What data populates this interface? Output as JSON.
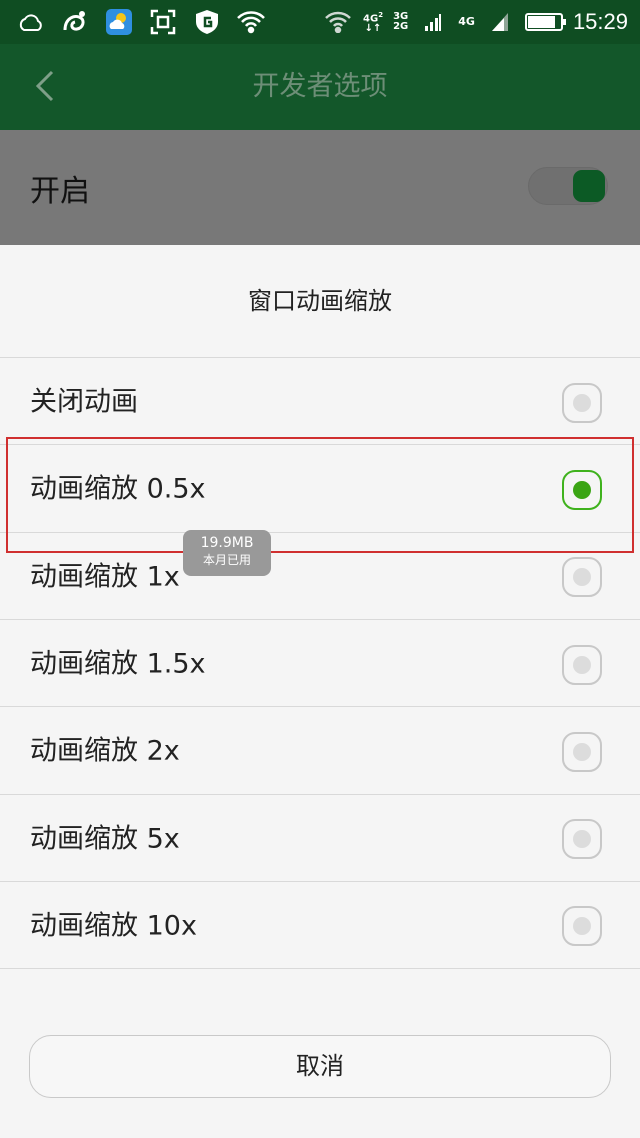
{
  "status_bar": {
    "time": "15:29",
    "net1_top": "4G",
    "net1_sup": "2",
    "net2_top": "3G",
    "net2_bottom": "2G",
    "net3": "4G",
    "icons": [
      "weather-cloud-icon",
      "uc-browser-icon",
      "weather-app-icon",
      "scan-icon",
      "shield-g-icon",
      "wifi-icon"
    ],
    "battery_level": 0.85
  },
  "app_bar": {
    "title": "开发者选项"
  },
  "setting": {
    "label": "开启",
    "toggle_on": true
  },
  "dialog": {
    "title": "窗口动画缩放",
    "options": [
      {
        "label": "关闭动画",
        "selected": false
      },
      {
        "label": "动画缩放 0.5x",
        "selected": true
      },
      {
        "label": "动画缩放 1x",
        "selected": false
      },
      {
        "label": "动画缩放 1.5x",
        "selected": false
      },
      {
        "label": "动画缩放 2x",
        "selected": false
      },
      {
        "label": "动画缩放 5x",
        "selected": false
      },
      {
        "label": "动画缩放 10x",
        "selected": false
      }
    ],
    "cancel_label": "取消"
  },
  "data_toast": {
    "amount": "19.9MB",
    "caption": "本月已用"
  },
  "colors": {
    "status_bar": "#0f4d22",
    "app_bar": "#13572a",
    "accent_green": "#3aa414",
    "highlight_red": "#d03030"
  }
}
